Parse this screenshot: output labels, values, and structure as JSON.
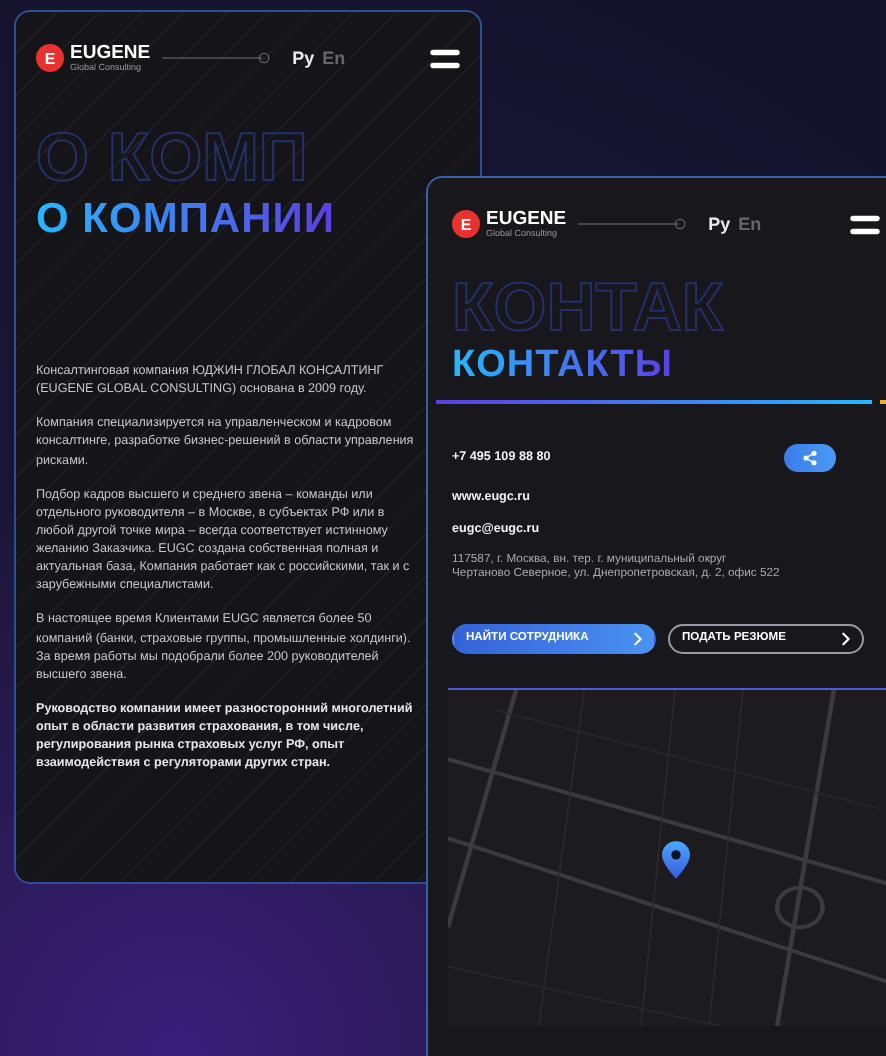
{
  "about_screen": {
    "header": {
      "logo_letter": "E",
      "brand": "EUGENE",
      "tagline": "Global Consulting",
      "languages": [
        {
          "label": "Ру",
          "selected": true
        },
        {
          "label": "En",
          "selected": false
        }
      ]
    },
    "watermark": "О КОМП",
    "title": "О КОМПАНИИ",
    "paragraphs": [
      {
        "text": "Консалтинговая компания ЮДЖИН ГЛОБАЛ КОНСАЛТИНГ (EUGENE GLOBAL CONSULTING) основана в 2009 году.",
        "bold": false
      },
      {
        "text": "Компания специализируется на управленческом и кадровом консалтинге, разработке бизнес-решений в области управления рисками.",
        "bold": false
      },
      {
        "text": "Подбор кадров высшего и среднего звена – команды или отдельного руководителя – в Москве, в субъектах РФ или в любой другой точке мира – всегда соответствует истинному желанию Заказчика. EUGC создана собственная полная и актуальная база, Компания работает как с российскими, так и с зарубежными специалистами.",
        "bold": false
      },
      {
        "text": "В настоящее время Клиентами EUGC является более 50 компаний (банки, страховые группы, промышленные холдинги). За время работы мы подобрали более 200 руководителей высшего звена.",
        "bold": false
      },
      {
        "text": "Руководство компании имеет разносторонний многолетний опыт в области развития страхования, в том числе, регулирования рынка страховых услуг РФ, опыт взаимодействия с регуляторами других стран.",
        "bold": true
      }
    ]
  },
  "contacts_screen": {
    "header": {
      "logo_letter": "E",
      "brand": "EUGENE",
      "tagline": "Global Consulting",
      "languages": [
        {
          "label": "Ру",
          "selected": true
        },
        {
          "label": "En",
          "selected": false
        }
      ]
    },
    "watermark": "КОНТАК",
    "title": "КОНТАКТЫ",
    "phone": "+7 495 109 88 80",
    "website": "www.eugc.ru",
    "email": "eugc@eugc.ru",
    "address": [
      "117587, г. Москва, вн. тер. г. муниципальный округ",
      "Чертаново Северное, ул. Днепропетровская, д. 2, офис 522"
    ],
    "buttons": [
      {
        "label": "НАЙТИ СОТРУДНИКА",
        "kind": "primary"
      },
      {
        "label": "ПОДАТЬ РЕЗЮМЕ",
        "kind": "outline"
      }
    ]
  }
}
